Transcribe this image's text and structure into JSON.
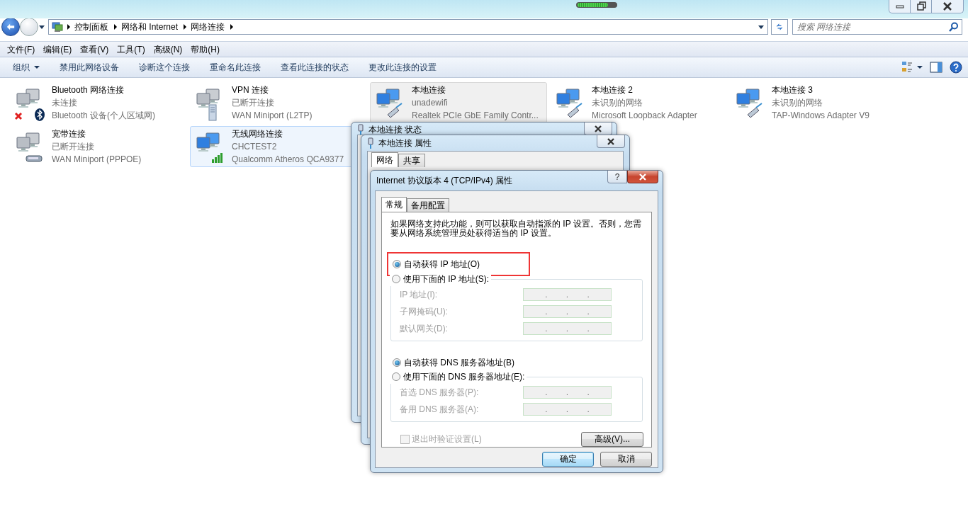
{
  "address_bar": {
    "crumbs": [
      "控制面板",
      "网络和 Internet",
      "网络连接"
    ]
  },
  "search": {
    "placeholder": "搜索 网络连接"
  },
  "menu": [
    "文件(F)",
    "编辑(E)",
    "查看(V)",
    "工具(T)",
    "高级(N)",
    "帮助(H)"
  ],
  "toolbar": [
    {
      "label": "组织",
      "dropdown": true
    },
    {
      "label": "禁用此网络设备",
      "dropdown": false
    },
    {
      "label": "诊断这个连接",
      "dropdown": false
    },
    {
      "label": "重命名此连接",
      "dropdown": false
    },
    {
      "label": "查看此连接的状态",
      "dropdown": false
    },
    {
      "label": "更改此连接的设置",
      "dropdown": false
    }
  ],
  "connections": [
    {
      "name": "Bluetooth 网络连接",
      "status": "未连接",
      "device": "Bluetooth 设备(个人区域网)",
      "kind": "bluetooth",
      "disconnected": true,
      "selected": false,
      "hovered": false
    },
    {
      "name": "VPN 连接",
      "status": "已断开连接",
      "device": "WAN Miniport (L2TP)",
      "kind": "vpn",
      "disconnected": true,
      "selected": false,
      "hovered": false
    },
    {
      "name": "本地连接",
      "status": "unadewifi",
      "device": "Realtek PCIe GbE Family Contr...",
      "kind": "ethernet",
      "disconnected": false,
      "selected": true,
      "hovered": false
    },
    {
      "name": "本地连接 2",
      "status": "未识别的网络",
      "device": "Microsoft Loopback Adapter",
      "kind": "ethernet",
      "disconnected": false,
      "selected": false,
      "hovered": false
    },
    {
      "name": "本地连接 3",
      "status": "未识别的网络",
      "device": "TAP-Windows Adapter V9",
      "kind": "ethernet",
      "disconnected": false,
      "selected": false,
      "hovered": false
    },
    {
      "name": "宽带连接",
      "status": "已断开连接",
      "device": "WAN Miniport (PPPOE)",
      "kind": "modem",
      "disconnected": true,
      "selected": false,
      "hovered": false
    },
    {
      "name": "无线网络连接",
      "status": "CHCTEST2",
      "device": "Qualcomm Atheros QCA9377",
      "kind": "wireless",
      "disconnected": false,
      "selected": false,
      "hovered": true
    }
  ],
  "status_dialog": {
    "title": "本地连接 状态"
  },
  "properties_dialog": {
    "title": "本地连接 属性",
    "tabs": [
      {
        "label": "网络",
        "selected": true
      },
      {
        "label": "共享",
        "selected": false
      }
    ]
  },
  "ipv4_dialog": {
    "title": "Internet 协议版本 4 (TCP/IPv4) 属性",
    "help": "?",
    "tabs": [
      {
        "label": "常规",
        "selected": true
      },
      {
        "label": "备用配置",
        "selected": false
      }
    ],
    "description": "如果网络支持此功能，则可以获取自动指派的 IP 设置。否则，您需要从网络系统管理员处获得适当的 IP 设置。",
    "sections": [
      {
        "auto": {
          "label": "自动获得 IP 地址(O)",
          "selected": true,
          "highlighted": true
        },
        "manual": {
          "label": "使用下面的 IP 地址(S):",
          "selected": false
        },
        "fields": [
          {
            "label": "IP 地址(I):",
            "value": ". . .",
            "disabled": true
          },
          {
            "label": "子网掩码(U):",
            "value": ". . .",
            "disabled": true
          },
          {
            "label": "默认网关(D):",
            "value": ". . .",
            "disabled": true
          }
        ]
      },
      {
        "auto": {
          "label": "自动获得 DNS 服务器地址(B)",
          "selected": true,
          "highlighted": false
        },
        "manual": {
          "label": "使用下面的 DNS 服务器地址(E):",
          "selected": false
        },
        "fields": [
          {
            "label": "首选 DNS 服务器(P):",
            "value": ". . .",
            "disabled": true
          },
          {
            "label": "备用 DNS 服务器(A):",
            "value": ". . .",
            "disabled": true
          }
        ]
      }
    ],
    "validate": {
      "label": "退出时验证设置(L)",
      "checked": false,
      "disabled": true
    },
    "advanced_button": "高级(V)...",
    "buttons": [
      {
        "label": "确定",
        "default": true
      },
      {
        "label": "取消",
        "default": false
      }
    ]
  }
}
